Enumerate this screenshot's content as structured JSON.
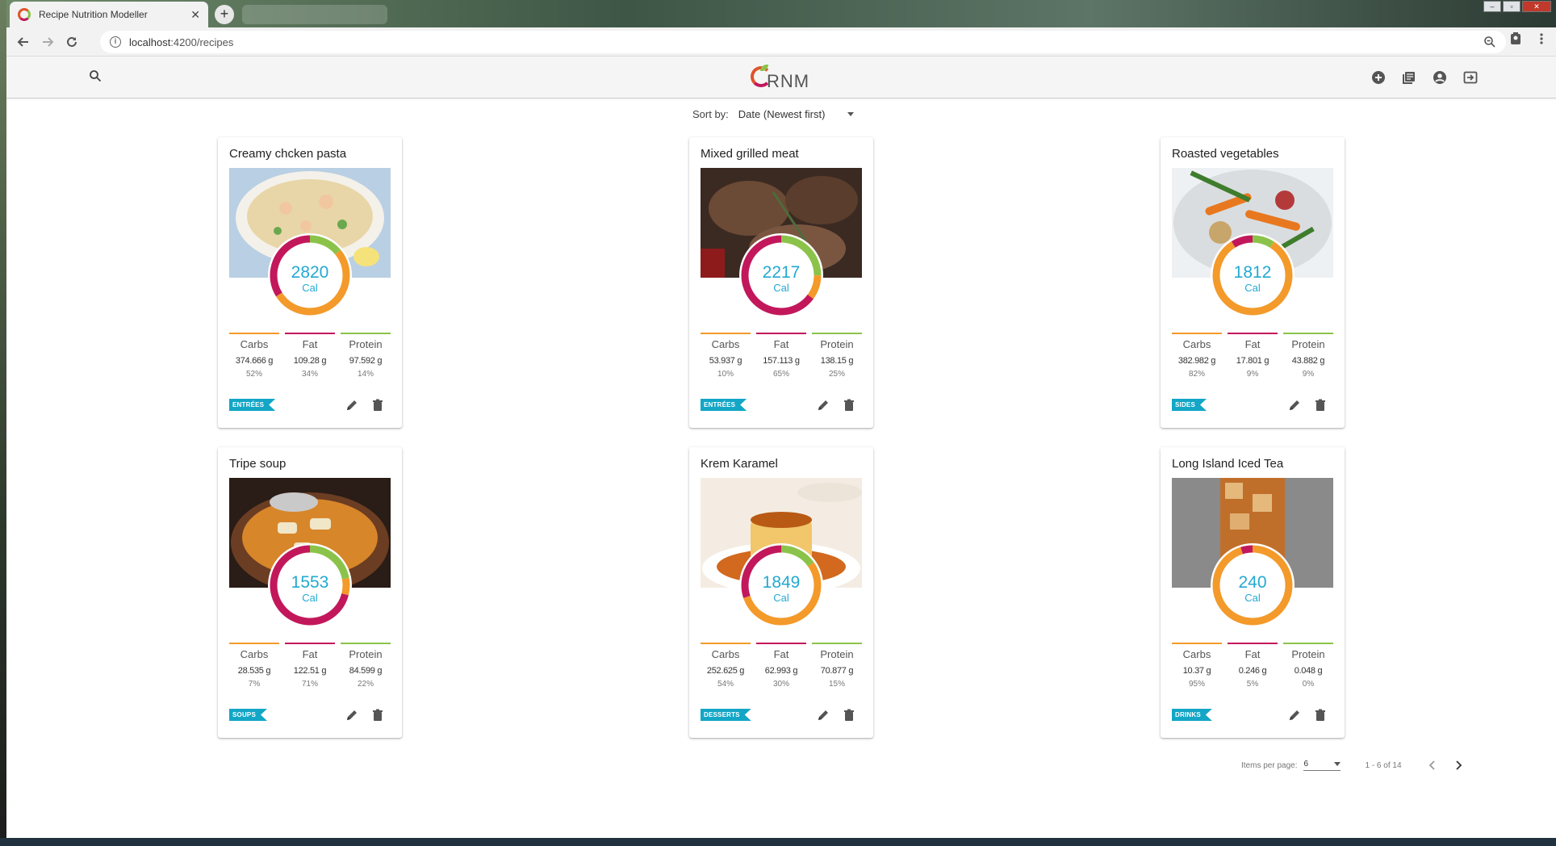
{
  "browser": {
    "tab_title": "Recipe Nutrition Modeller",
    "url_host": "localhost",
    "url_path": ":4200/recipes"
  },
  "app": {
    "logo_text": "RNM",
    "sort": {
      "label": "Sort by:",
      "value": "Date (Newest first)"
    },
    "paginator": {
      "items_label": "Items per page:",
      "items_value": "6",
      "range": "1 - 6 of 14"
    }
  },
  "macro_labels": {
    "carbs": "Carbs",
    "fat": "Fat",
    "protein": "Protein"
  },
  "colors": {
    "carbs": "#f39a2a",
    "fat": "#c2185b",
    "protein": "#8bc34a",
    "calories_text": "#23a9d2",
    "tag": "#13a6c6"
  },
  "recipes": [
    {
      "name": "Creamy chcken pasta",
      "calories": "2820",
      "cal_unit": "Cal",
      "tag": "ENTRÉES",
      "image": "pasta",
      "carbs_g": "374.666 g",
      "carbs_pct": "52%",
      "fat_g": "109.28 g",
      "fat_pct": "34%",
      "protein_g": "97.592 g",
      "protein_pct": "14%"
    },
    {
      "name": "Mixed grilled meat",
      "calories": "2217",
      "cal_unit": "Cal",
      "tag": "ENTRÉES",
      "image": "meat",
      "carbs_g": "53.937 g",
      "carbs_pct": "10%",
      "fat_g": "157.113 g",
      "fat_pct": "65%",
      "protein_g": "138.15 g",
      "protein_pct": "25%"
    },
    {
      "name": "Roasted vegetables",
      "calories": "1812",
      "cal_unit": "Cal",
      "tag": "SIDES",
      "image": "vegetables",
      "carbs_g": "382.982 g",
      "carbs_pct": "82%",
      "fat_g": "17.801 g",
      "fat_pct": "9%",
      "protein_g": "43.882 g",
      "protein_pct": "9%"
    },
    {
      "name": "Tripe soup",
      "calories": "1553",
      "cal_unit": "Cal",
      "tag": "SOUPS",
      "image": "soup",
      "carbs_g": "28.535 g",
      "carbs_pct": "7%",
      "fat_g": "122.51 g",
      "fat_pct": "71%",
      "protein_g": "84.599 g",
      "protein_pct": "22%"
    },
    {
      "name": "Krem Karamel",
      "calories": "1849",
      "cal_unit": "Cal",
      "tag": "DESSERTS",
      "image": "caramel",
      "carbs_g": "252.625 g",
      "carbs_pct": "54%",
      "fat_g": "62.993 g",
      "fat_pct": "30%",
      "protein_g": "70.877 g",
      "protein_pct": "15%"
    },
    {
      "name": "Long Island Iced Tea",
      "calories": "240",
      "cal_unit": "Cal",
      "tag": "DRINKS",
      "image": "drink",
      "carbs_g": "10.37 g",
      "carbs_pct": "95%",
      "fat_g": "0.246 g",
      "fat_pct": "5%",
      "protein_g": "0.048 g",
      "protein_pct": "0%"
    }
  ]
}
